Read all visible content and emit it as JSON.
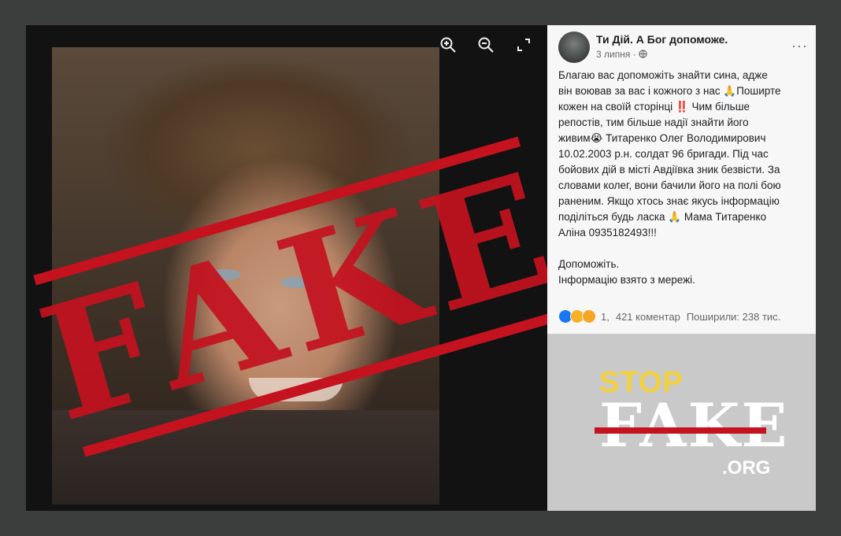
{
  "post": {
    "page_name": "Ти Дій. А Бог допоможе.",
    "date": "3 липня",
    "audience_icon": "globe-icon",
    "more_label": "···",
    "body_lines": [
      "Благаю вас допоможіть знайти сина, адже",
      "він воював за вас і кожного з нас 🙏Поширте",
      "кожен на своїй сторінці ‼️ Чим більше",
      "репостів, тим більше надії знайти його",
      "живим😭 Титаренко Олег Володимирович",
      "10.02.2003 р.н. солдат 96 бригади. Під час",
      "бойових дій в місті Авдіївка зник безвісти. За",
      "словами колег, вони бачили його на полі бою",
      "раненим. Якщо хтось знає якусь інформацію",
      "поділіться будь ласка 🙏 Мама Титаренко",
      "Аліна 0935182493!!!"
    ],
    "footer_lines": [
      "Допоможіть.",
      "Інформацію взято з мережі."
    ],
    "reactions_count": "1,",
    "comments": "421 коментар",
    "shares": "Поширили: 238 тис."
  },
  "stamp": {
    "text": "FAKE",
    "color": "#c4121f"
  },
  "logo": {
    "line1": "STOP",
    "line2": "FAKE",
    "line3": ".ORG",
    "accent": "#f3d03e"
  },
  "viewer_tools": [
    "zoom-in-icon",
    "zoom-out-icon",
    "fullscreen-icon"
  ]
}
